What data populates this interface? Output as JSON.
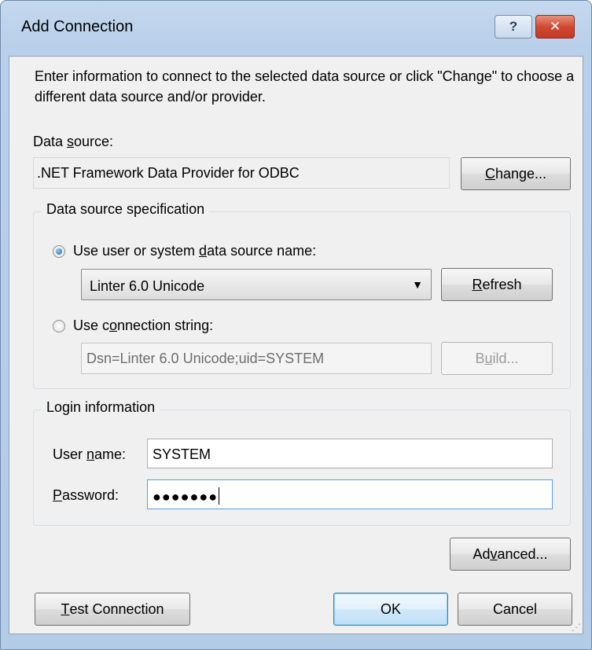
{
  "window": {
    "title": "Add Connection",
    "help_glyph": "?",
    "close_glyph": "✕"
  },
  "intro_text": "Enter information to connect to the selected data source or click \"Change\" to choose a different data source and/or provider.",
  "data_source": {
    "label_pre": "Data ",
    "label_accel": "s",
    "label_post": "ource:",
    "value": ".NET Framework Data Provider for ODBC",
    "change_accel": "C",
    "change_post": "hange..."
  },
  "spec": {
    "legend": "Data source specification",
    "dsn_radio_pre": "Use user or system ",
    "dsn_radio_accel": "d",
    "dsn_radio_post": "ata source name:",
    "dsn_selected": "Linter 6.0 Unicode",
    "combo_arrow": "▼",
    "refresh_accel": "R",
    "refresh_post": "efresh",
    "connstr_radio_pre": "Use c",
    "connstr_radio_accel": "o",
    "connstr_radio_post": "nnection string:",
    "connstr_value": "Dsn=Linter 6.0 Unicode;uid=SYSTEM",
    "build_pre": "B",
    "build_accel": "u",
    "build_post": "ild..."
  },
  "login": {
    "legend": "Login information",
    "username_pre": "User ",
    "username_accel": "n",
    "username_post": "ame:",
    "username_value": "SYSTEM",
    "password_accel": "P",
    "password_post": "assword:",
    "password_mask": "●●●●●●●"
  },
  "buttons": {
    "advanced_pre": "Ad",
    "advanced_accel": "v",
    "advanced_post": "anced...",
    "test_accel": "T",
    "test_post": "est Connection",
    "ok": "OK",
    "cancel": "Cancel"
  },
  "resize_grip": "⋰"
}
